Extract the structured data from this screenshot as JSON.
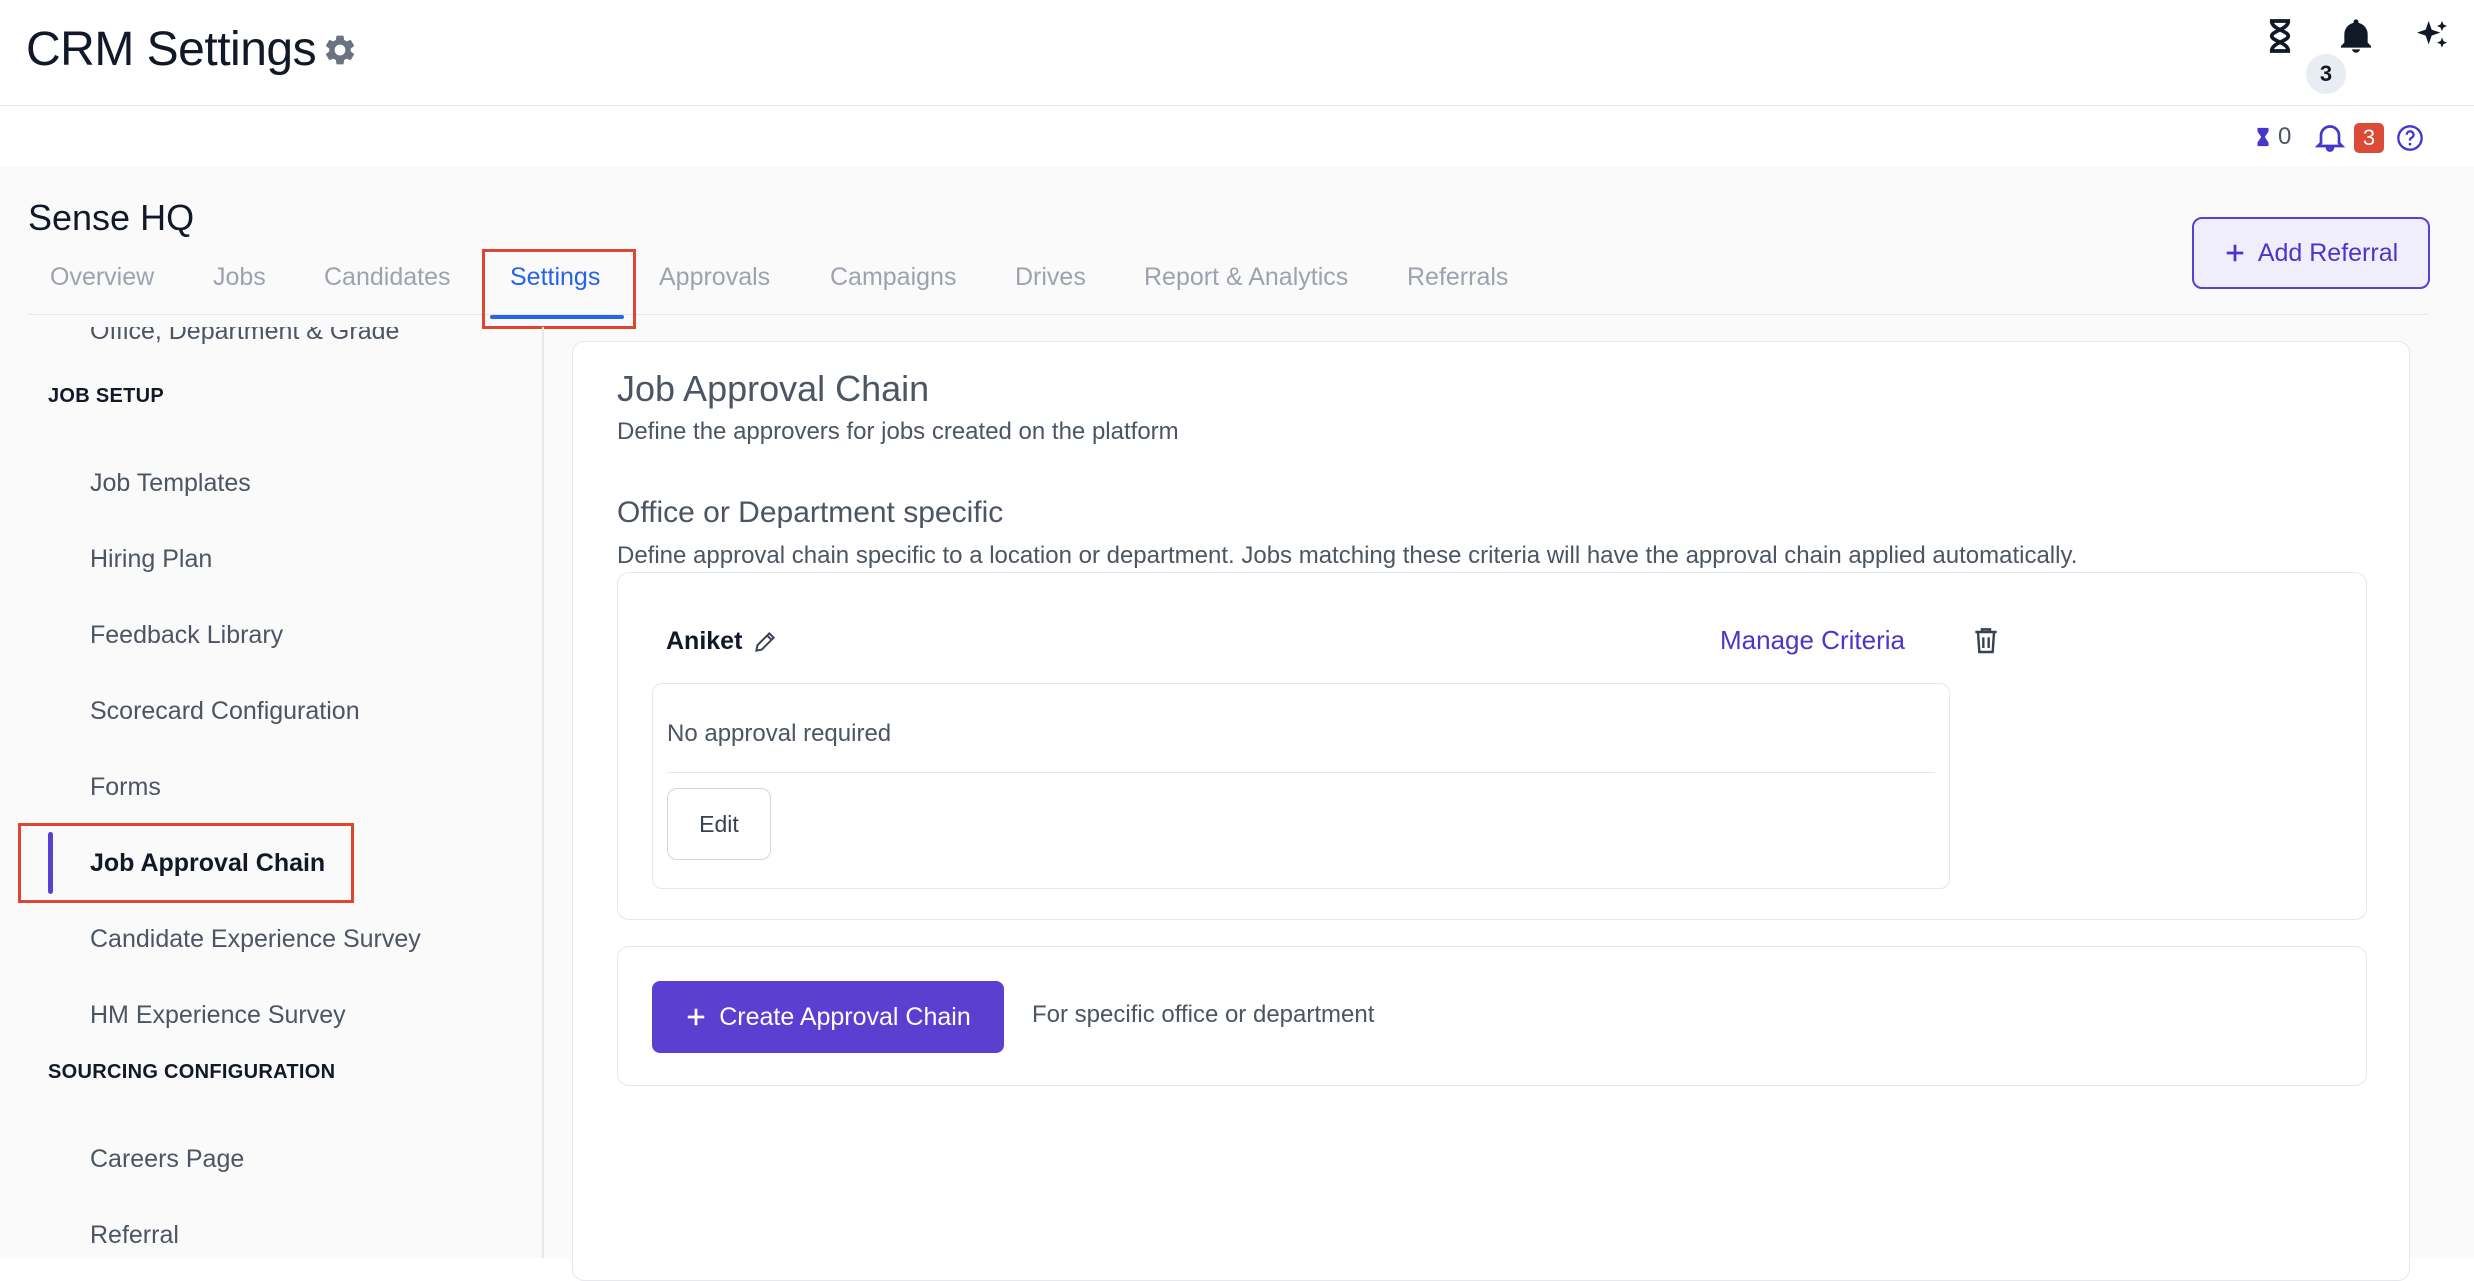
{
  "header": {
    "title": "CRM Settings",
    "notification_count": "3"
  },
  "subbar": {
    "timer_count": "0",
    "alert_count": "3"
  },
  "org": {
    "name": "Sense HQ"
  },
  "tabs": [
    {
      "label": "Overview"
    },
    {
      "label": "Jobs"
    },
    {
      "label": "Candidates"
    },
    {
      "label": "Settings"
    },
    {
      "label": "Approvals"
    },
    {
      "label": "Campaigns"
    },
    {
      "label": "Drives"
    },
    {
      "label": "Report & Analytics"
    },
    {
      "label": "Referrals"
    }
  ],
  "add_referral": {
    "label": "Add Referral"
  },
  "sidebar": {
    "partial_item": "Office, Department & Grade",
    "job_setup_heading": "JOB SETUP",
    "job_setup_items": [
      {
        "label": "Job Templates"
      },
      {
        "label": "Hiring Plan"
      },
      {
        "label": "Feedback Library"
      },
      {
        "label": "Scorecard Configuration"
      },
      {
        "label": "Forms"
      },
      {
        "label": "Job Approval Chain"
      },
      {
        "label": "Candidate Experience Survey"
      },
      {
        "label": "HM Experience Survey"
      }
    ],
    "sourcing_heading": "SOURCING CONFIGURATION",
    "sourcing_items": [
      {
        "label": "Careers Page"
      },
      {
        "label": "Referral"
      }
    ]
  },
  "main": {
    "title": "Job Approval Chain",
    "subtitle": "Define the approvers for jobs created on the platform",
    "section_title": "Office or Department specific",
    "section_desc": "Define approval chain specific to a location or department. Jobs matching these criteria will have the approval chain applied automatically.",
    "chain": {
      "name": "Aniket",
      "manage_label": "Manage Criteria",
      "status": "No approval required",
      "edit_label": "Edit"
    },
    "create": {
      "label": "Create Approval Chain",
      "hint": "For specific office or department"
    }
  },
  "colors": {
    "accent": "#5b3fd1",
    "tab_active": "#2563eb",
    "highlight": "#e0452f"
  }
}
